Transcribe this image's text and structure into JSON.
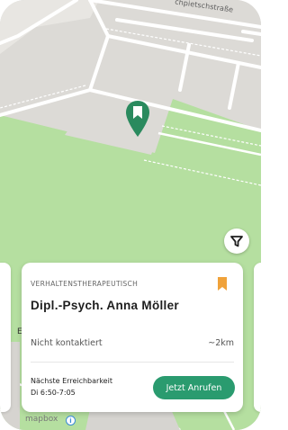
{
  "map": {
    "street_label": "chpietschstraße",
    "attribution_logo": "mapbox",
    "info_icon_glyph": "i",
    "side_card_letter": "E",
    "colors": {
      "park": "#b5dfa0",
      "block": "#dcdad6",
      "road": "#ffffff",
      "pin": "#2a8a5e"
    }
  },
  "icons": {
    "pin": "map-marker-bookmark-icon",
    "filter": "filter-funnel-icon",
    "bookmark": "bookmark-icon",
    "info": "info-icon"
  },
  "card": {
    "category": "VERHALTENSTHERAPEUTISCH",
    "name": "Dipl.-Psych. Anna Möller",
    "contact_status": "Nicht kontaktiert",
    "distance": "~2km",
    "availability_label": "Nächste Erreichbarkeit",
    "availability_time": "Di 6:50-7:05",
    "call_button_label": "Jetzt Anrufen",
    "accent_color": "#2a9b6f",
    "bookmark_color": "#f0a23a"
  }
}
